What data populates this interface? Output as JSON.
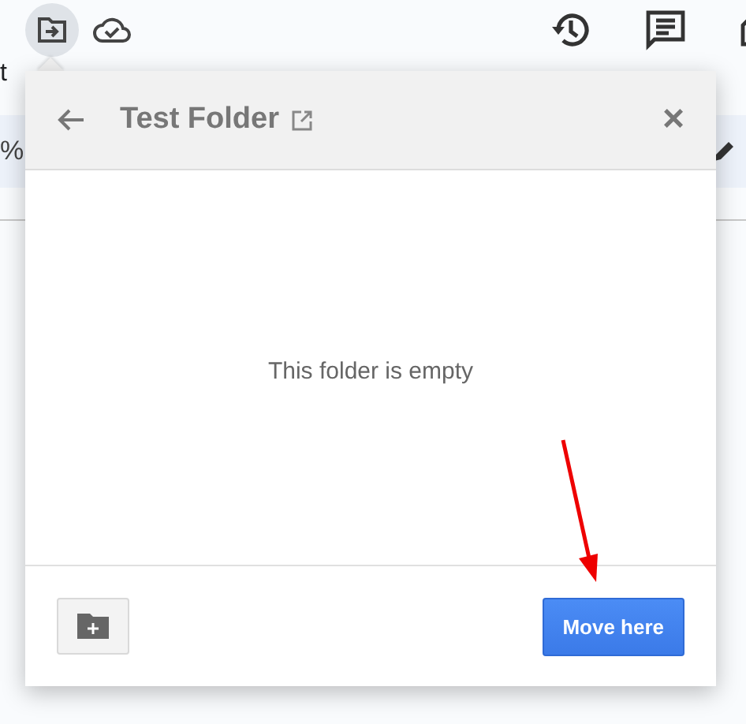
{
  "toolbar": {
    "move_button": {
      "selected": true
    }
  },
  "menu": [
    "t"
  ],
  "format_bar": {
    "zoom_text": "%"
  },
  "dialog": {
    "title": "Test Folder",
    "close": "×",
    "empty_message": "This folder is empty",
    "primary_button": "Move here"
  }
}
